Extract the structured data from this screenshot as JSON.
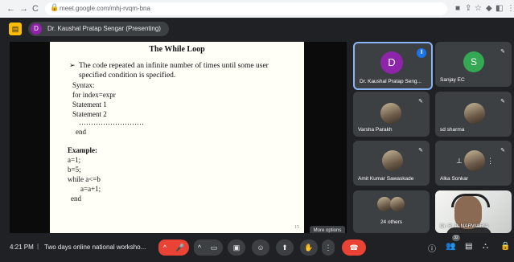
{
  "browser": {
    "back_glyph": "←",
    "forward_glyph": "→",
    "reload_glyph": "C",
    "home_glyph": "⌂",
    "url": "meet.google.com/mhj-rvqm-bna",
    "right_icons": [
      "■",
      "⇪",
      "☆",
      "◆",
      "◧",
      "⋮"
    ]
  },
  "banner": {
    "presenter_initial": "D",
    "presenting_text": "Dr. Kaushal Pratap Sengar (Presenting)"
  },
  "slide": {
    "title": "The While Loop",
    "bullet_marker": "➢",
    "bullet_text": "The code repeated an infinite number of times until some user specified condition is specified.",
    "syntax_label": "Syntax:",
    "syntax_lines": [
      "for index=expr",
      "Statement 1",
      "Statement 2",
      "………………………",
      "end"
    ],
    "example_label": "Example:",
    "example_lines": [
      "a=1;",
      "b=5;",
      "while a<=b",
      "a=a+1;",
      "end"
    ],
    "page_number": "15"
  },
  "participants": [
    {
      "name": "Dr. Kaushal Pratap Seng...",
      "initial": "D",
      "avatar_color": "#8e24aa",
      "speaking": true
    },
    {
      "name": "Sanjay EC",
      "initial": "S",
      "avatar_color": "#34a853",
      "muted": true
    },
    {
      "name": "Varsha Parakh",
      "muted": true
    },
    {
      "name": "sd sharma",
      "muted": true
    },
    {
      "name": "Amit Kumar Sawaskade",
      "muted": true
    },
    {
      "name": "Alka Sonkar",
      "muted": true
    },
    {
      "name": "24 others"
    },
    {
      "name": "Dr. R. P. NARWARIA"
    }
  ],
  "bottom": {
    "time": "4:21 PM",
    "separator": "|",
    "meeting_title": "Two days online national worksho...",
    "tooltip": "More options",
    "people_count": "32",
    "controls": [
      "^",
      "🎤",
      "^",
      "▭",
      "▣",
      "☺",
      "⬆",
      "✋",
      "⋮",
      "☎"
    ],
    "right_icons": [
      "ⓘ",
      "👥",
      "▤",
      "⛬",
      "🔒"
    ]
  },
  "colors": {
    "background": "#202124",
    "tile": "#3c4043",
    "hangup": "#ea4335",
    "highlight": "#8ab4f8"
  }
}
